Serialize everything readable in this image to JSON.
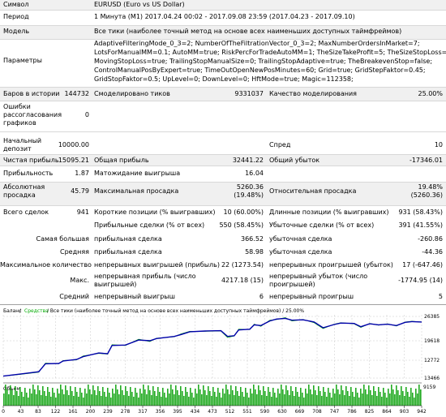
{
  "report": {
    "symbol_label": "Символ",
    "symbol_value": "EURUSD (Euro vs US Dollar)",
    "period_label": "Период",
    "period_value": "1 Минута (M1) 2017.04.24 00:02 - 2017.09.08 23:59 (2017.04.23 - 2017.09.10)",
    "model_label": "Модель",
    "model_value": "Все тики (наиболее точный метод на основе всех наименьших доступных таймфреймов)",
    "params_label": "Параметры",
    "params_lines": [
      "AdaptiveFilteringMode_0_3=2; NumberOfTheFiltrationVector_0_3=2; MaxNumberOrdersInMarket=7;",
      "LotsForManualMM=0.1; AutoMM=true; RiskPercForTradeAutoMM=1; TheSizeTakeProfit=5; TheSizeStopLoss=3;",
      "MovingStopLoss=true; TrailingStopManualSize=0; TrailingStopAdaptive=true; TheBreakevenStop=false;",
      "ControlManualPosByExpert=true; TimeOutOpenNewPosMinutes=60; Grid=true; GridStepFaktor=0.45;",
      "GridStopFaktor=0.5; UpLevel=0; DownLevel=0; HftMode=true; Magic=112358;"
    ],
    "bars_label": "Баров в истории",
    "bars_value": "144732",
    "ticks_label": "Смоделировано тиков",
    "ticks_value": "9331037",
    "quality_label": "Качество моделирования",
    "quality_value": "25.00%",
    "errors_label_lines": [
      "Ошибки",
      "рассогласования",
      "графиков"
    ],
    "errors_value": "0",
    "deposit_label_lines": [
      "Начальный",
      "депозит"
    ],
    "deposit_value": "10000.00",
    "spread_label": "Спред",
    "spread_value": "10",
    "net_profit_label": "Чистая прибыль",
    "net_profit_value": "15095.21",
    "gross_profit_label": "Общая прибыль",
    "gross_profit_value": "32441.22",
    "gross_loss_label": "Общий убыток",
    "gross_loss_value": "-17346.01",
    "pf_label": "Прибыльность",
    "pf_value": "1.87",
    "expected_label": "Матожидание выигрыша",
    "expected_value": "16.04",
    "abs_dd_label_lines": [
      "Абсолютная",
      "просадка"
    ],
    "abs_dd_value": "45.79",
    "max_dd_label": "Максимальная просадка",
    "max_dd_value_lines": [
      "5260.36",
      "(19.48%)"
    ],
    "rel_dd_label": "Относительная просадка",
    "rel_dd_value_lines": [
      "19.48%",
      "(5260.36)"
    ],
    "total_trades_label": "Всего сделок",
    "total_trades_value": "941",
    "short_label": "Короткие позиции (% выигравших)",
    "short_value": "10 (60.00%)",
    "long_label": "Длинные позиции (% выигравших)",
    "long_value": "931 (58.43%)",
    "profit_trades_label": "Прибыльные сделки (% от всех)",
    "profit_trades_value": "550 (58.45%)",
    "loss_trades_label": "Убыточные сделки (% от всех)",
    "loss_trades_value": "391 (41.55%)",
    "largest_label": "Самая большая",
    "largest_profit_label": "прибыльная сделка",
    "largest_profit_value": "366.52",
    "largest_loss_label": "убыточная сделка",
    "largest_loss_value": "-260.86",
    "average_label": "Средняя",
    "average_profit_label": "прибыльная сделка",
    "average_profit_value": "58.98",
    "average_loss_label": "убыточная сделка",
    "average_loss_value": "-44.36",
    "max_count_label": "Максимальное количество",
    "max_cons_wins_label": "непрерывных выигрышей (прибыль)",
    "max_cons_wins_value": "22 (1273.54)",
    "max_cons_losses_label": "непрерывных проигрышей (убыток)",
    "max_cons_losses_value": "17 (-647.46)",
    "max_label": "Макс.",
    "max_cons_profit_label_lines": [
      "непрерывная прибыль (число",
      "выигрышей)"
    ],
    "max_cons_profit_value": "4217.18 (15)",
    "max_cons_loss_label_lines": [
      "непрерывный убыток (число",
      "проигрышей)"
    ],
    "max_cons_loss_value": "-1774.95 (14)",
    "avg_label": "Средний",
    "avg_cons_wins_label": "непрерывный выигрыш",
    "avg_cons_wins_value": "6",
    "avg_cons_losses_label": "непрерывный проигрыш",
    "avg_cons_losses_value": "5"
  },
  "chart_header": {
    "balance": "Баланс",
    "sep1": " / ",
    "equity": "Средства",
    "rest": " / Все тики (наиболее точный метод на основе всех наименьших доступных таймфреймов) / 25.00%"
  },
  "chart_data": {
    "type": "line",
    "y_ticks": [
      "26385",
      "19618",
      "12772",
      "13466"
    ],
    "volume_label": "Объем",
    "x_ticks": [
      "0",
      "43",
      "83",
      "122",
      "161",
      "200",
      "239",
      "278",
      "317",
      "356",
      "395",
      "434",
      "473",
      "512",
      "551",
      "590",
      "630",
      "669",
      "708",
      "747",
      "786",
      "825",
      "864",
      "903",
      "942"
    ],
    "volume_max_label": "9159",
    "series": [
      {
        "name": "Баланс",
        "color": "#0000aa",
        "x": [
          0,
          40,
          80,
          95,
          125,
          135,
          165,
          180,
          215,
          235,
          245,
          275,
          305,
          330,
          345,
          385,
          400,
          420,
          455,
          490,
          505,
          520,
          530,
          555,
          565,
          580,
          600,
          615,
          635,
          650,
          675,
          700,
          720,
          745,
          760,
          790,
          805,
          825,
          845,
          865,
          885,
          905,
          920,
          942
        ],
        "y": [
          10000,
          10600,
          11200,
          13400,
          13500,
          14200,
          14600,
          15400,
          16400,
          16200,
          18500,
          18600,
          20000,
          19800,
          20400,
          21000,
          21500,
          22300,
          22500,
          22600,
          21000,
          21200,
          22800,
          23000,
          24200,
          24000,
          25300,
          25800,
          26000,
          25500,
          25600,
          25000,
          23400,
          24300,
          24700,
          24600,
          23700,
          24500,
          24200,
          24400,
          24000,
          24900,
          25100,
          25000
        ]
      },
      {
        "name": "Средства",
        "color": "#00aa00",
        "x": [
          0,
          40,
          80,
          95,
          125,
          135,
          165,
          180,
          215,
          235,
          245,
          275,
          305,
          330,
          345,
          385,
          400,
          420,
          455,
          490,
          505,
          520,
          530,
          555,
          565,
          580,
          600,
          615,
          635,
          650,
          675,
          700,
          720,
          745,
          760,
          790,
          805,
          825,
          845,
          865,
          885,
          905,
          920,
          942
        ],
        "y": [
          10000,
          10500,
          11100,
          13600,
          13400,
          14300,
          14500,
          15600,
          16300,
          16100,
          18700,
          18500,
          20200,
          19600,
          20500,
          20900,
          21700,
          22400,
          22400,
          22500,
          20700,
          21100,
          23000,
          22900,
          24400,
          23800,
          25500,
          25700,
          26200,
          25300,
          25700,
          24800,
          23200,
          24400,
          24800,
          24500,
          23500,
          24600,
          24100,
          24500,
          23900,
          25000,
          25200,
          25000
        ]
      }
    ]
  }
}
